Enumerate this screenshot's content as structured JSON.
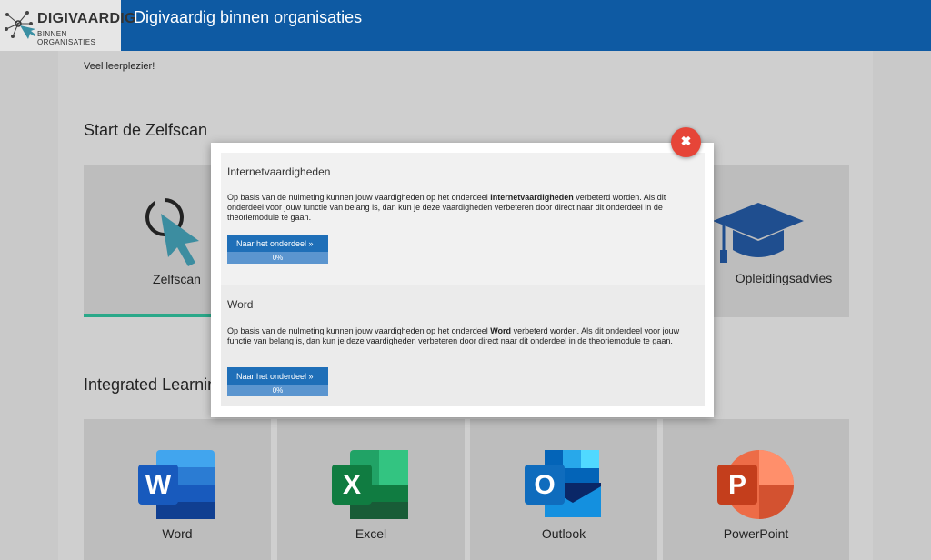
{
  "header": {
    "logo_title": "DIGIVAARDIG",
    "logo_sub": "BINNEN ORGANISATIES",
    "app_title": "Digivaardig binnen organisaties"
  },
  "main": {
    "intro": "Veel leerplezier!",
    "zelfscan_section": "Start de Zelfscan",
    "tiles": {
      "zelfscan": "Zelfscan",
      "opleidingsadvies": "Opleidingsadvies"
    },
    "integrated_section": "Integrated Learning",
    "apps": [
      {
        "label": "Word",
        "letter": "W",
        "color": "#185abd"
      },
      {
        "label": "Excel",
        "letter": "X",
        "color": "#107c41"
      },
      {
        "label": "Outlook",
        "letter": "O",
        "color": "#0f6cbd"
      },
      {
        "label": "PowerPoint",
        "letter": "P",
        "color": "#c43e1c"
      }
    ]
  },
  "modal": {
    "close_icon": "close-icon",
    "items": [
      {
        "title": "Internetvaardigheden",
        "text_before": "Op basis van de nulmeting kunnen jouw vaardigheden op het onderdeel ",
        "bold": "Internetvaardigheden",
        "text_after": " verbeterd worden. Als dit onderdeel voor jouw functie van belang is, dan kun je deze vaardigheden verbeteren door direct naar dit onderdeel in de theoriemodule te gaan.",
        "button": "Naar het onderdeel »",
        "progress": 0,
        "progress_label": "0%"
      },
      {
        "title": "Word",
        "text_before": "Op basis van de nulmeting kunnen jouw vaardigheden op het onderdeel ",
        "bold": "Word",
        "text_after": " verbeterd worden. Als dit onderdeel voor jouw functie van belang is, dan kun je deze vaardigheden verbeteren door direct naar dit onderdeel in de theoriemodule te gaan.",
        "button": "Naar het onderdeel »",
        "progress": 0,
        "progress_label": "0%"
      }
    ]
  },
  "colors": {
    "header": "#0e5aa3",
    "button": "#1f6fb8",
    "close": "#e64538",
    "active_tab": "#2aa889"
  }
}
